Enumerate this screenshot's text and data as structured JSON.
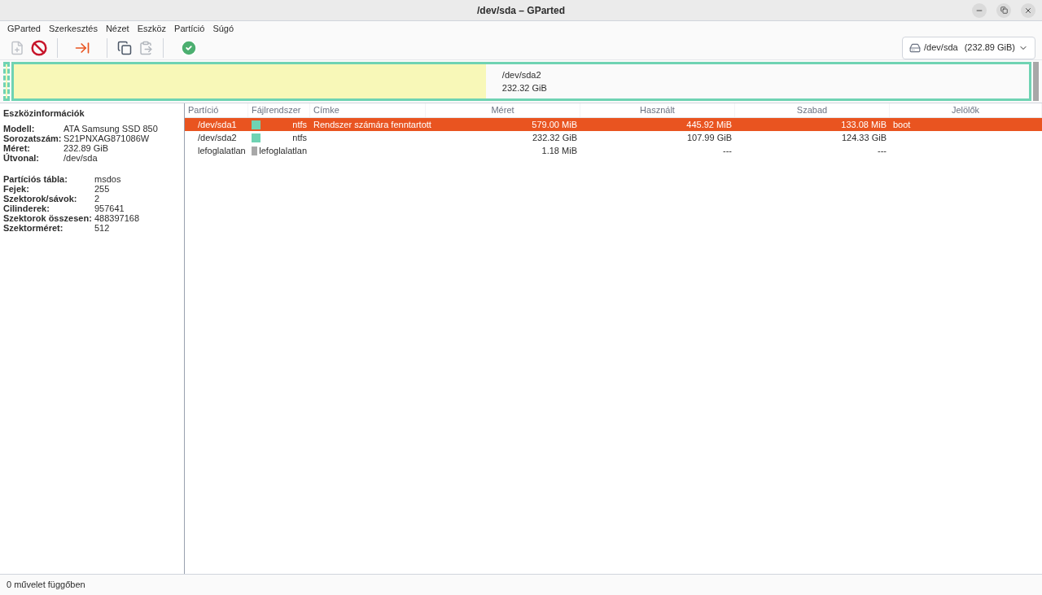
{
  "window": {
    "title": "/dev/sda – GParted"
  },
  "menu": [
    "GParted",
    "Szerkesztés",
    "Nézet",
    "Eszköz",
    "Partíció",
    "Súgó"
  ],
  "toolbar": [
    {
      "kind": "new",
      "disabled": true
    },
    {
      "kind": "delete",
      "disabled": false
    },
    {
      "kind": "sep"
    },
    {
      "kind": "resize",
      "disabled": false
    },
    {
      "kind": "sep"
    },
    {
      "kind": "copy",
      "disabled": false
    },
    {
      "kind": "paste",
      "disabled": true
    },
    {
      "kind": "sep"
    },
    {
      "kind": "apply",
      "disabled": false
    }
  ],
  "device_selector": {
    "value": "/dev/sda",
    "size": "(232.89 GiB)"
  },
  "disk_map": [
    {
      "kind": "sliver",
      "color": "#6fd3b3",
      "selected": true
    },
    {
      "kind": "main",
      "color": "#6fd3b3",
      "level": 0.465,
      "name": "/dev/sda2",
      "size": "232.32 GiB",
      "selected": false
    },
    {
      "kind": "unallocated",
      "color": "#a8a8a8"
    }
  ],
  "device_info": {
    "title": "Eszközinformációk",
    "group_1": [
      {
        "label": "Modell:",
        "value": "ATA Samsung SSD 850"
      },
      {
        "label": "Sorozatszám:",
        "value": "S21PNXAG871086W"
      },
      {
        "label": "Méret:",
        "value": "232.89 GiB"
      },
      {
        "label": "Útvonal:",
        "value": "/dev/sda"
      }
    ],
    "group_2": [
      {
        "label": "Partíciós tábla:",
        "value": "msdos"
      },
      {
        "label": "Fejek:",
        "value": "255"
      },
      {
        "label": "Szektorok/sávok:",
        "value": "2"
      },
      {
        "label": "Cilinderek:",
        "value": "957641"
      },
      {
        "label": "Szektorok összesen:",
        "value": "488397168"
      },
      {
        "label": "Szektorméret:",
        "value": "512"
      }
    ]
  },
  "table": {
    "columns": [
      "Partíció",
      "Fájlrendszer",
      "Címke",
      "Méret",
      "Használt",
      "Szabad",
      "Jelölők"
    ],
    "rows": [
      {
        "partition": "/dev/sda1",
        "color": "#6fd3b3",
        "filesystem": "ntfs",
        "label": "Rendszer számára fenntartott",
        "size": "579.00 MiB",
        "used": "445.92 MiB",
        "free": "133.08 MiB",
        "flags": "boot",
        "selected": true
      },
      {
        "partition": "/dev/sda2",
        "color": "#6fd3b3",
        "filesystem": "ntfs",
        "label": "",
        "size": "232.32 GiB",
        "used": "107.99 GiB",
        "free": "124.33 GiB",
        "flags": "",
        "selected": false
      },
      {
        "partition": "lefoglalatlan",
        "color": "#a8a8a8",
        "filesystem": "lefoglalatlan",
        "label": "",
        "size": "1.18 MiB",
        "used": "---",
        "free": "---",
        "flags": "",
        "selected": false
      }
    ]
  },
  "status_bar": "0 művelet függőben"
}
